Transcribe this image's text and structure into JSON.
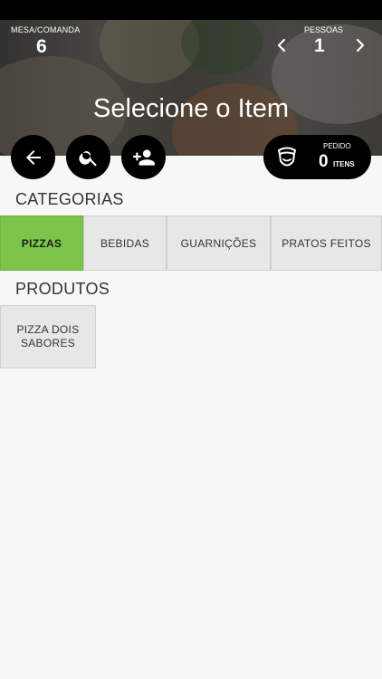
{
  "header": {
    "mesa_label": "MESA/COMANDA",
    "mesa_value": "6",
    "pessoas_label": "PESSOAS",
    "pessoas_value": "1",
    "title": "Selecione o Item"
  },
  "actions": {
    "icons": [
      "arrow-left-icon",
      "search-icon",
      "person-add-icon"
    ]
  },
  "pedido": {
    "label": "PEDIDO",
    "count": "0",
    "unit": "ITENS",
    "icon": "chef-hat-icon"
  },
  "categorias": {
    "title": "CATEGORIAS",
    "tabs": [
      {
        "label": "PIZZAS",
        "active": true
      },
      {
        "label": "BEBIDAS",
        "active": false
      },
      {
        "label": "GUARNIÇÕES",
        "active": false
      },
      {
        "label": "PRATOS FEITOS",
        "active": false
      }
    ],
    "active_color": "#7cc54a"
  },
  "produtos": {
    "title": "PRODUTOS",
    "items": [
      {
        "label": "PIZZA DOIS SABORES"
      }
    ]
  }
}
